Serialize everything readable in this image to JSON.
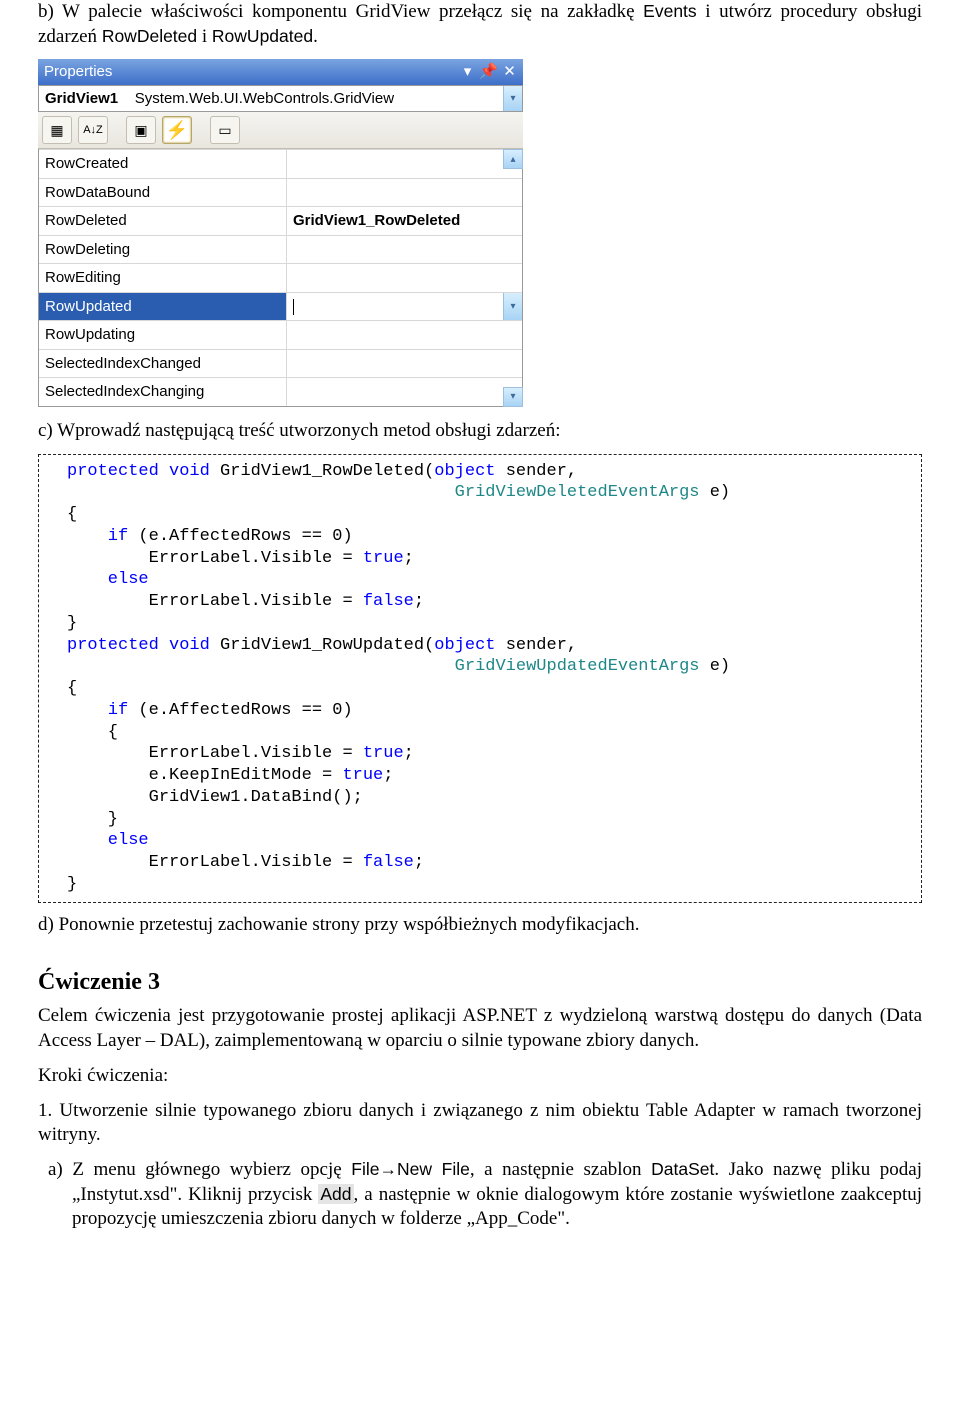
{
  "intro_b": {
    "prefix": "b) W palecie właściwości komponentu GridView przełącz się na zakładkę ",
    "events": "Events",
    "mid": " i utwórz procedury obsługi zdarzeń ",
    "rd": "RowDeleted",
    "and": " i ",
    "ru": "RowUpdated",
    "end": "."
  },
  "props": {
    "title": "Properties",
    "obj_bold": "GridView1",
    "obj_rest": "System.Web.UI.WebControls.GridView",
    "rows": [
      {
        "name": "RowCreated",
        "val": ""
      },
      {
        "name": "RowDataBound",
        "val": ""
      },
      {
        "name": "RowDeleted",
        "val": "GridView1_RowDeleted"
      },
      {
        "name": "RowDeleting",
        "val": ""
      },
      {
        "name": "RowEditing",
        "val": ""
      },
      {
        "name": "RowUpdated",
        "val": ""
      },
      {
        "name": "RowUpdating",
        "val": ""
      },
      {
        "name": "SelectedIndexChanged",
        "val": ""
      },
      {
        "name": "SelectedIndexChanging",
        "val": ""
      }
    ],
    "selected_index": 5
  },
  "para_c": "c) Wprowadź następującą treść utworzonych metod obsługi zdarzeń:",
  "code": {
    "l01a": "protected",
    "l01b": " void",
    "l01c": " GridView1_RowDeleted(",
    "l01d": "object",
    "l01e": " sender,",
    "l02a": "GridViewDeletedEventArgs",
    "l02b": " e)",
    "l03": "{",
    "l04a": "    if",
    "l04b": " (e.AffectedRows == 0)",
    "l05a": "        ErrorLabel.Visible = ",
    "l05b": "true",
    "l05c": ";",
    "l06": "    else",
    "l07a": "        ErrorLabel.Visible = ",
    "l07b": "false",
    "l07c": ";",
    "l08": "}",
    "l09a": "protected",
    "l09b": " void",
    "l09c": " GridView1_RowUpdated(",
    "l09d": "object",
    "l09e": " sender,",
    "l10a": "GridViewUpdatedEventArgs",
    "l10b": " e)",
    "l11": "{",
    "l12a": "    if",
    "l12b": " (e.AffectedRows == 0)",
    "l13": "    {",
    "l14a": "        ErrorLabel.Visible = ",
    "l14b": "true",
    "l14c": ";",
    "l15a": "        e.KeepInEditMode = ",
    "l15b": "true",
    "l15c": ";",
    "l16": "        GridView1.DataBind();",
    "l17": "    }",
    "l18": "    else",
    "l19a": "        ErrorLabel.Visible = ",
    "l19b": "false",
    "l19c": ";",
    "l20": "}"
  },
  "para_d": "d) Ponownie przetestuj zachowanie strony przy współbieżnych modyfikacjach.",
  "ex3": {
    "heading": "Ćwiczenie 3",
    "p1": "Celem ćwiczenia jest przygotowanie prostej aplikacji ASP.NET z wydzieloną warstwą dostępu do danych (Data Access Layer – DAL), zaimplementowaną w oparciu o silnie typowane zbiory danych.",
    "p2": "Kroki ćwiczenia:",
    "p3": "1. Utworzenie silnie typowanego zbioru danych i związanego z nim obiektu Table Adapter w ramach tworzonej witryny.",
    "a_pre": "a)  Z menu głównego wybierz opcję ",
    "a_file": "File→New File",
    "a_mid1": ", a następnie szablon ",
    "a_ds": "DataSet",
    "a_mid2": ". Jako nazwę pliku podaj „Instytut.xsd\". Kliknij przycisk ",
    "a_add": "Add",
    "a_tail": ", a następnie w oknie dialogowym które zostanie wyświetlone zaakceptuj propozycję umieszczenia zbioru danych w folderze „App_Code\"."
  }
}
